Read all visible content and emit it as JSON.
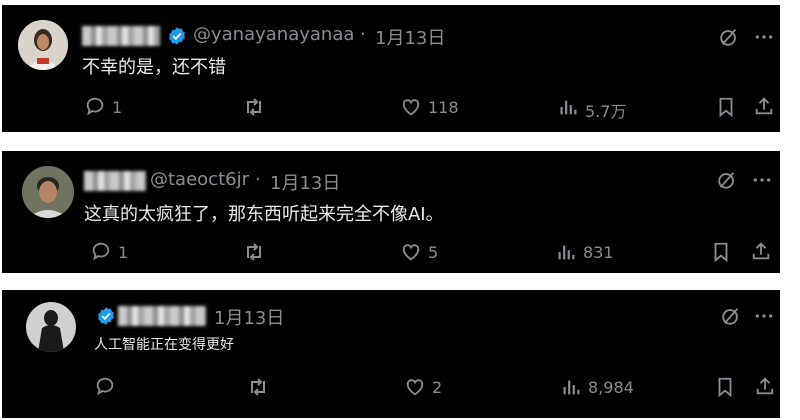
{
  "posts": [
    {
      "handle": "@yanayanayanaa",
      "separator": "·",
      "date": "1月13日",
      "text": "不幸的是，还不错",
      "replies": "1",
      "likes": "118",
      "views": "5.7万"
    },
    {
      "handle": "@taeoct6jr",
      "separator": "·",
      "date": "1月13日",
      "text": "这真的太疯狂了，那东西听起来完全不像AI。",
      "replies": "1",
      "likes": "5",
      "views": "831"
    },
    {
      "handle": "",
      "separator": "",
      "date": "1月13日",
      "text": "人工智能正在变得更好",
      "replies": "",
      "likes": "2",
      "views": "8,984"
    }
  ],
  "colors": {
    "background": "#000000",
    "text": "#e7e9ea",
    "muted": "#8a8d91",
    "verified": "#1d9bf0"
  },
  "icons": [
    "reply-icon",
    "repost-icon",
    "like-icon",
    "views-icon",
    "bookmark-icon",
    "share-icon",
    "grok-icon",
    "more-icon",
    "verified-badge"
  ]
}
